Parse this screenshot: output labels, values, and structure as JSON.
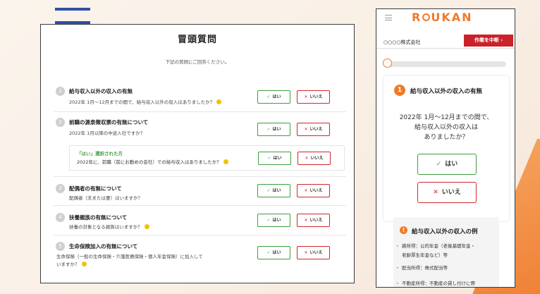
{
  "desktop": {
    "title": "冒頭質問",
    "subtitle": "下記の質問にご回答ください。",
    "yes_label": "はい",
    "no_label": "いいえ",
    "questions": [
      {
        "num": "1",
        "title": "給与収入以外の収入の有無",
        "desc": "2022年 1月〜12月までの間で、給与収入以外の収入はありましたか？"
      },
      {
        "num": "2",
        "title": "前職の源泉徴収票の有無について",
        "desc": "2022年 1月以降の中途入社ですか？"
      },
      {
        "num": "3",
        "title": "配偶者の有無について",
        "desc": "配偶者（夫または妻）はいますか？"
      },
      {
        "num": "4",
        "title": "扶養親族の有無について",
        "desc": "扶養の対象となる親族はいますか？"
      },
      {
        "num": "5",
        "title": "生命保険加入の有無について",
        "desc_line1": "生命保険（一般の生命保険・介護医療保険・個人年金保険）に加入して",
        "desc_line2": "いますか？"
      }
    ],
    "sub_question": {
      "label": "「はい」選択された方",
      "desc": "2022年に、前職（前にお勤めの会社）での給与収入はありましたか？"
    }
  },
  "mobile": {
    "logo_left": "R",
    "logo_right": "UKAN",
    "company": "○○○○株式会社",
    "stop_label": "作業を中断 ›",
    "progress": 0.04,
    "question": {
      "num": "1",
      "title": "給与収入以外の収入の有無",
      "line1": "2022年 1月〜12月までの間で、",
      "line2": "給与収入以外の収入は",
      "line3": "ありましたか？"
    },
    "yes_label": "はい",
    "no_label": "いいえ",
    "examples": {
      "title": "給与収入以外の収入の例",
      "item1_line1": "雑所得：公的年金（老後基礎年金・",
      "item1_line2": "老齢厚生年金など）等",
      "item2": "配当所得：株式配当等",
      "item3": "不動産所得：不動産の貸し付けに際"
    }
  },
  "colors": {
    "accent": "#ef7a2a",
    "yes": "#3f9e3f",
    "no": "#d0282e",
    "stop": "#c9222a"
  }
}
